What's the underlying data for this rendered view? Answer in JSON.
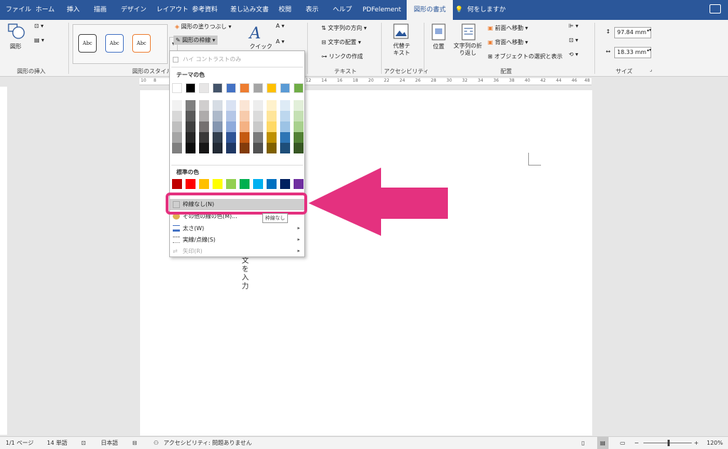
{
  "tabs": [
    "ファイル",
    "ホーム",
    "挿入",
    "描画",
    "デザイン",
    "レイアウト",
    "参考資料",
    "差し込み文書",
    "校閲",
    "表示",
    "ヘルプ",
    "PDFelement",
    "図形の書式"
  ],
  "active_tab": "図形の書式",
  "tell_me": "何をしますか",
  "ribbon": {
    "insert_shapes": {
      "label": "図形の挿入",
      "shapes_btn": "図形"
    },
    "shape_styles": {
      "label": "図形のスタイル",
      "style_samples": [
        "Abc",
        "Abc",
        "Abc"
      ],
      "fill_btn": "図形の塗りつぶし",
      "outline_btn": "図形の枠線"
    },
    "wordart": {
      "quick_btn": "クイック"
    },
    "text": {
      "label": "テキスト",
      "direction_btn": "文字列の方向",
      "align_btn": "文字の配置",
      "link_btn": "リンクの作成"
    },
    "accessibility": {
      "label": "アクセシビリティ",
      "alt_text_btn": "代替テキスト"
    },
    "arrange": {
      "label": "配置",
      "position_btn": "位置",
      "wrap_btn": "文字列の折り返し",
      "forward_btn": "前面へ移動",
      "backward_btn": "背面へ移動",
      "selection_btn": "オブジェクトの選択と表示"
    },
    "size": {
      "label": "サイズ",
      "height": "97.84 mm",
      "width": "18.33 mm"
    }
  },
  "menu": {
    "high_contrast": "ハイ コントラストのみ",
    "theme_colors_label": "テーマの色",
    "theme_colors": [
      "#ffffff",
      "#000000",
      "#e7e6e6",
      "#44546a",
      "#4472c4",
      "#ed7d31",
      "#a5a5a5",
      "#ffc000",
      "#5b9bd5",
      "#70ad47"
    ],
    "theme_shades": [
      [
        "#f2f2f2",
        "#7f7f7f",
        "#d0cece",
        "#d6dce4",
        "#d9e2f3",
        "#fbe5d5",
        "#ededed",
        "#fff2cc",
        "#deebf6",
        "#e2efd9"
      ],
      [
        "#d8d8d8",
        "#595959",
        "#aeabab",
        "#adb9ca",
        "#b4c6e7",
        "#f7cbac",
        "#dbdbdb",
        "#ffe599",
        "#bdd7ee",
        "#c5e0b3"
      ],
      [
        "#bfbfbf",
        "#3f3f3f",
        "#757070",
        "#8496b0",
        "#8eaadb",
        "#f4b183",
        "#c9c9c9",
        "#ffd966",
        "#9cc3e5",
        "#a8d08d"
      ],
      [
        "#a5a5a5",
        "#262626",
        "#3a3838",
        "#323f4f",
        "#2f5496",
        "#c55a11",
        "#7b7b7b",
        "#bf9000",
        "#2e75b5",
        "#538135"
      ],
      [
        "#7f7f7f",
        "#0c0c0c",
        "#171616",
        "#222a35",
        "#1f3864",
        "#833c0b",
        "#525252",
        "#7f6000",
        "#1e4e79",
        "#375623"
      ]
    ],
    "standard_colors_label": "標準の色",
    "standard_colors": [
      "#c00000",
      "#ff0000",
      "#ffc000",
      "#ffff00",
      "#92d050",
      "#00b050",
      "#00b0f0",
      "#0070c0",
      "#002060",
      "#7030a0"
    ],
    "no_outline": "枠線なし(N)",
    "more_colors": "その他の線の色(M)...",
    "weight": "太さ(W)",
    "dashes": "実線/点線(S)",
    "arrows": "矢印(R)",
    "tooltip": "枠線なし"
  },
  "ruler_numbers": [
    "10",
    "8",
    "6",
    "4",
    "2",
    "2",
    "4",
    "6",
    "8",
    "10",
    "12",
    "14",
    "16",
    "18",
    "20",
    "22",
    "24",
    "26",
    "28",
    "30",
    "32",
    "34",
    "36",
    "38",
    "40",
    "42",
    "44",
    "46",
    "48"
  ],
  "document": {
    "vertical_text": [
      "文",
      "を",
      "入",
      "力"
    ]
  },
  "status": {
    "page": "1/1 ページ",
    "words": "14 単語",
    "language": "日本語",
    "accessibility": "アクセシビリティ: 問題ありません",
    "zoom": "120%"
  },
  "colors": {
    "accent": "#2b579a",
    "highlight": "#e4317f"
  }
}
